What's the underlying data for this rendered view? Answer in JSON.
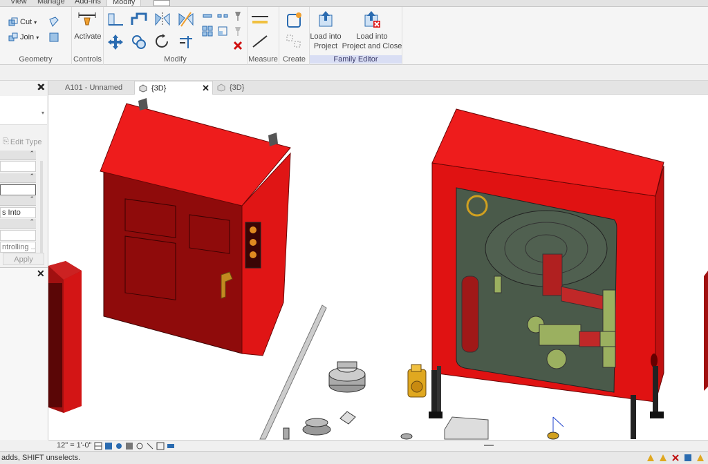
{
  "ribbon_tabs": [
    {
      "label": "View"
    },
    {
      "label": "Manage"
    },
    {
      "label": "Add-Ins"
    },
    {
      "label": "Modify"
    }
  ],
  "ribbon": {
    "geometry": {
      "cut_label": "Cut",
      "join_label": "Join",
      "panel_label": "Geometry"
    },
    "controls": {
      "activate_label": "Activate",
      "panel_label": "Controls"
    },
    "modify": {
      "panel_label": "Modify"
    },
    "measure": {
      "panel_label": "Measure"
    },
    "create": {
      "panel_label": "Create"
    },
    "family_editor": {
      "load_into_project_line1": "Load into",
      "load_into_project_line2": "Project",
      "load_close_line1": "Load into",
      "load_close_line2": "Project and Close",
      "panel_label": "Family Editor"
    }
  },
  "properties": {
    "edit_type_label": "Edit Type",
    "rows": [
      "s Into",
      "ntrolling ..."
    ],
    "apply_label": "Apply"
  },
  "view_tabs": [
    {
      "label": "A101 - Unnamed"
    },
    {
      "label": "{3D}"
    },
    {
      "label": "{3D}"
    }
  ],
  "view_bar": {
    "scale": "12\" = 1'-0\""
  },
  "status": {
    "text": "adds, SHIFT unselects."
  },
  "colors": {
    "cabinet_red": "#e01010",
    "cabinet_dark": "#7a0a0a",
    "ribbon_bg": "#f5f5f5",
    "family_editor": "#d9def4"
  }
}
